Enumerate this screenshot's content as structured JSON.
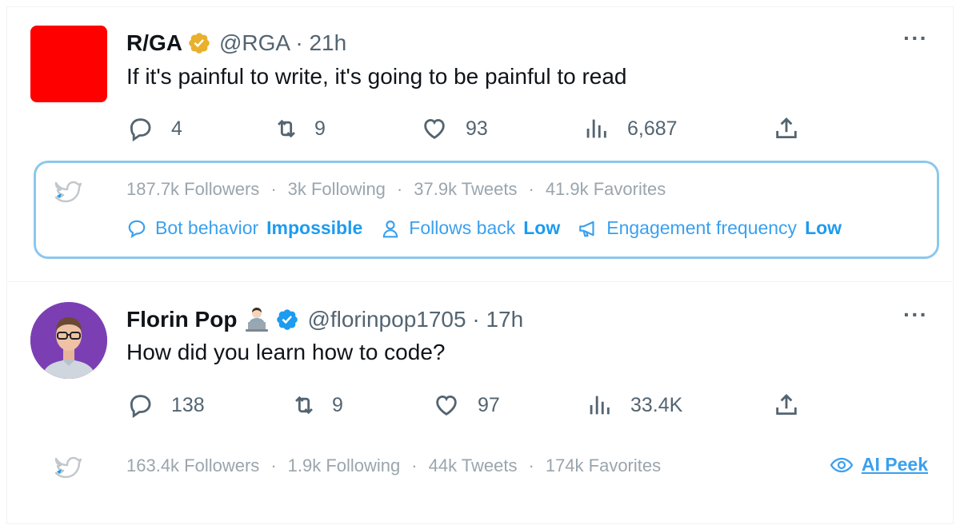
{
  "tweets": [
    {
      "name": "R/GA",
      "handle": "@RGA · 21h",
      "text": "If it's painful to write, it's going to be painful to read",
      "replies": "4",
      "retweets": "9",
      "likes": "93",
      "views": "6,687",
      "stats": {
        "followers": "187.7k Followers",
        "following": "3k Following",
        "tweets": "37.9k Tweets",
        "favorites": "41.9k Favorites"
      },
      "metrics": [
        {
          "label": "Bot behavior",
          "value": "Impossible"
        },
        {
          "label": "Follows back",
          "value": "Low"
        },
        {
          "label": "Engagement frequency",
          "value": "Low"
        }
      ]
    },
    {
      "name": "Florin Pop",
      "handle": "@florinpop1705 · 17h",
      "text": "How did you learn how to code?",
      "replies": "138",
      "retweets": "9",
      "likes": "97",
      "views": "33.4K",
      "stats": {
        "followers": "163.4k Followers",
        "following": "1.9k Following",
        "tweets": "44k Tweets",
        "favorites": "174k Favorites"
      },
      "ai_peek": "AI Peek"
    }
  ],
  "separator": "·",
  "more": "···",
  "colors": {
    "accent": "#1d9bf0",
    "gold_badge": "#e8b02c",
    "blue_badge": "#1d9bf0",
    "muted": "#536471",
    "rga_brand": "#ff0000",
    "panel_border": "#8cc7ef"
  },
  "icons": [
    "reply-icon",
    "retweet-icon",
    "like-icon",
    "views-icon",
    "share-icon",
    "bird-icon",
    "more-icon",
    "speech-bubble-icon",
    "user-icon",
    "megaphone-icon",
    "eye-icon",
    "verified-badge-icon",
    "laptop-emoji-icon"
  ]
}
